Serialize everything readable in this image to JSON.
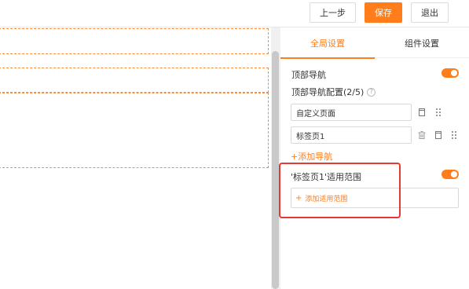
{
  "toolbar": {
    "prev_label": "上一步",
    "save_label": "保存",
    "exit_label": "退出"
  },
  "panel": {
    "tabs": [
      {
        "label": "全局设置",
        "active": true
      },
      {
        "label": "组件设置",
        "active": false
      }
    ],
    "top_nav_label": "顶部导航",
    "top_nav_enabled": true,
    "top_nav_config_label": "顶部导航配置(2/5)",
    "nav_items": [
      {
        "value": "自定义页面"
      },
      {
        "value": "标签页1"
      }
    ],
    "add_nav_label": "+添加导航",
    "scope_label": "'标签页1'适用范围",
    "scope_enabled": true,
    "add_scope_label": "添加适用范围"
  },
  "colors": {
    "accent": "#ff7d1a",
    "highlight": "#e53935"
  },
  "icons": [
    "help-icon",
    "copy-icon",
    "drag-handle-icon",
    "delete-icon",
    "plus-icon"
  ]
}
